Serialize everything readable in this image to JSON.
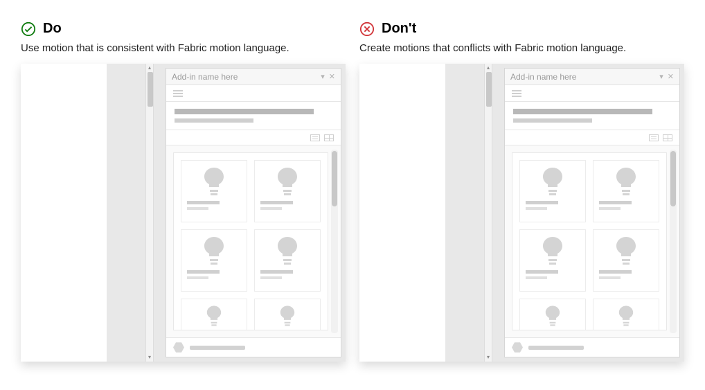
{
  "do": {
    "title": "Do",
    "description": "Use motion that is consistent with Fabric motion language."
  },
  "dont": {
    "title": "Don't",
    "description": "Create motions that conflicts with Fabric motion language."
  },
  "addin": {
    "title": "Add-in name here"
  },
  "colors": {
    "do": "#107c10",
    "dont": "#d13438"
  }
}
